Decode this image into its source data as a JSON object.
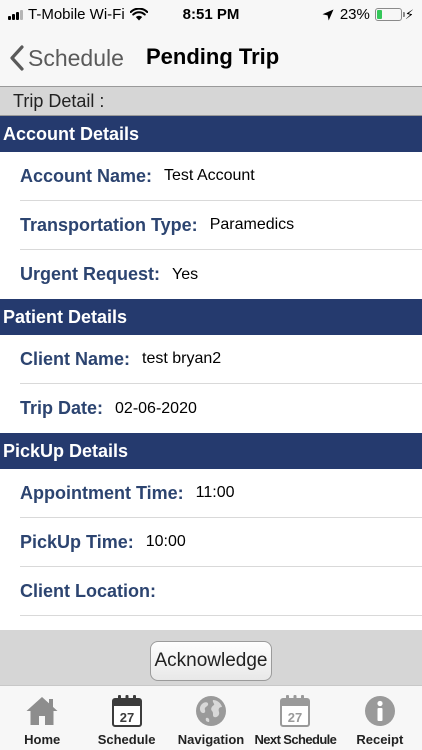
{
  "status_bar": {
    "carrier": "T-Mobile Wi-Fi",
    "time": "8:51 PM",
    "battery_percent": "23%",
    "battery_level": 0.23,
    "battery_color": "#34c759"
  },
  "nav": {
    "back_label": "Schedule",
    "title": "Pending Trip"
  },
  "subheader": "Trip Detail :",
  "sections": [
    {
      "title": "Account Details",
      "rows": [
        {
          "label": "Account Name:",
          "value": "Test Account"
        },
        {
          "label": "Transportation Type:",
          "value": "Paramedics"
        },
        {
          "label": "Urgent Request:",
          "value": "Yes"
        }
      ]
    },
    {
      "title": "Patient Details",
      "rows": [
        {
          "label": "Client Name:",
          "value": "test bryan2"
        },
        {
          "label": "Trip Date:",
          "value": "02-06-2020"
        }
      ]
    },
    {
      "title": "PickUp Details",
      "rows": [
        {
          "label": "Appointment Time:",
          "value": "11:00"
        },
        {
          "label": "PickUp Time:",
          "value": "10:00"
        },
        {
          "label": "Client Location:",
          "value": ""
        }
      ]
    }
  ],
  "acknowledge_label": "Acknowledge",
  "tabs": [
    {
      "label": "Home",
      "icon": "home-icon"
    },
    {
      "label": "Schedule",
      "icon": "calendar-icon",
      "day": "27"
    },
    {
      "label": "Navigation",
      "icon": "globe-icon"
    },
    {
      "label": "Next Schedule",
      "icon": "calendar-icon",
      "day": "27"
    },
    {
      "label": "Receipt",
      "icon": "info-icon"
    }
  ],
  "colors": {
    "section_header": "#253a6e",
    "label_text": "#2c4470"
  }
}
